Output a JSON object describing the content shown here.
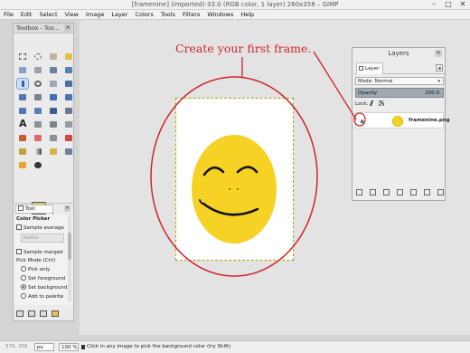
{
  "window": {
    "title": "[framenine] (imported)-33.0 (RGB color, 1 layer) 260x358 – GIMP"
  },
  "menubar": [
    "File",
    "Edit",
    "Select",
    "View",
    "Image",
    "Layer",
    "Colors",
    "Tools",
    "Filters",
    "Windows",
    "Help"
  ],
  "toolbox": {
    "title": "Toolbox - Too...",
    "tool_options_tab": "Tool Options",
    "color_picker": {
      "heading": "Color Picker",
      "sample_average": "Sample average",
      "radius_placeholder": "Radius",
      "sample_merged": "Sample merged",
      "pick_mode_label": "Pick Mode  (Ctrl)",
      "pick_modes": [
        "Pick only",
        "Set foreground",
        "Set background",
        "Add to palette"
      ],
      "selected_mode": "Set background"
    },
    "fg_color": "#f5d224",
    "bg_color": "#ffffff"
  },
  "layers_panel": {
    "title": "Layers",
    "tab_label": "Layer",
    "mode_label": "Mode:",
    "mode_value": "Normal",
    "opacity_label": "Opacity",
    "opacity_value": "100.0",
    "lock_label": "Lock:",
    "layer_name": "framenine.png"
  },
  "annotation": {
    "text": "Create your first frame.",
    "color": "#d0242a"
  },
  "statusbar": {
    "coords": "578, 356",
    "unit": "px",
    "zoom": "100 %",
    "message": "Click in any image to pick the background color (try Shift)"
  }
}
